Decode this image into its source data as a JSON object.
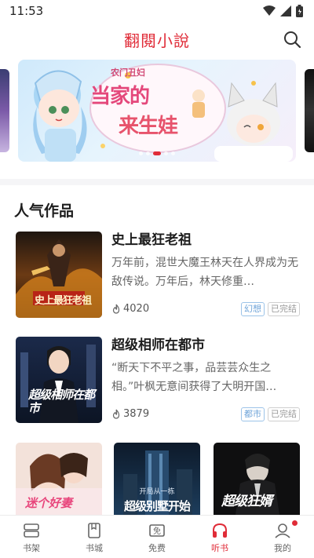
{
  "status_bar": {
    "time": "11:53",
    "icons": [
      "wifi-icon",
      "signal-icon",
      "battery-icon"
    ]
  },
  "header": {
    "title": "翻閱小說",
    "search_icon": "search-icon"
  },
  "banner": {
    "title_small": "农门丑妇",
    "title_large_1": "当家的",
    "title_large_2": "来生娃",
    "slide_count": 5,
    "active_slide": 3
  },
  "section": {
    "title": "人气作品"
  },
  "books": [
    {
      "title": "史上最狂老祖",
      "description": "万年前，混世大魔王林天在人界成为无敌传说。万年后，林天修重…",
      "heat": "4020",
      "genre_tag": "幻想",
      "status_tag": "已完结",
      "cover_text": "史上最狂老祖"
    },
    {
      "title": "超级相师在都市",
      "description": "“断天下不平之事，品芸芸众生之相。”叶枫无意间获得了大明开国…",
      "heat": "3879",
      "genre_tag": "都市",
      "status_tag": "已完结",
      "cover_text": "超级相师在都市"
    }
  ],
  "grid_books": [
    {
      "cover_text": "迷个好妻"
    },
    {
      "cover_text": "超级别墅开始",
      "cover_subtext": "开局从一栋"
    },
    {
      "cover_text": "超级狂婿"
    }
  ],
  "tab_bar": {
    "tabs": [
      {
        "label": "书架",
        "icon": "bookshelf-icon"
      },
      {
        "label": "书城",
        "icon": "bookstore-icon"
      },
      {
        "label": "免费",
        "icon": "free-icon"
      },
      {
        "label": "听书",
        "icon": "headphones-icon"
      },
      {
        "label": "我的",
        "icon": "profile-icon"
      }
    ],
    "active_tab": "听书"
  },
  "colors": {
    "accent": "#e02c38",
    "genre_tag": "#6da3d8",
    "status_tag": "#999999"
  }
}
